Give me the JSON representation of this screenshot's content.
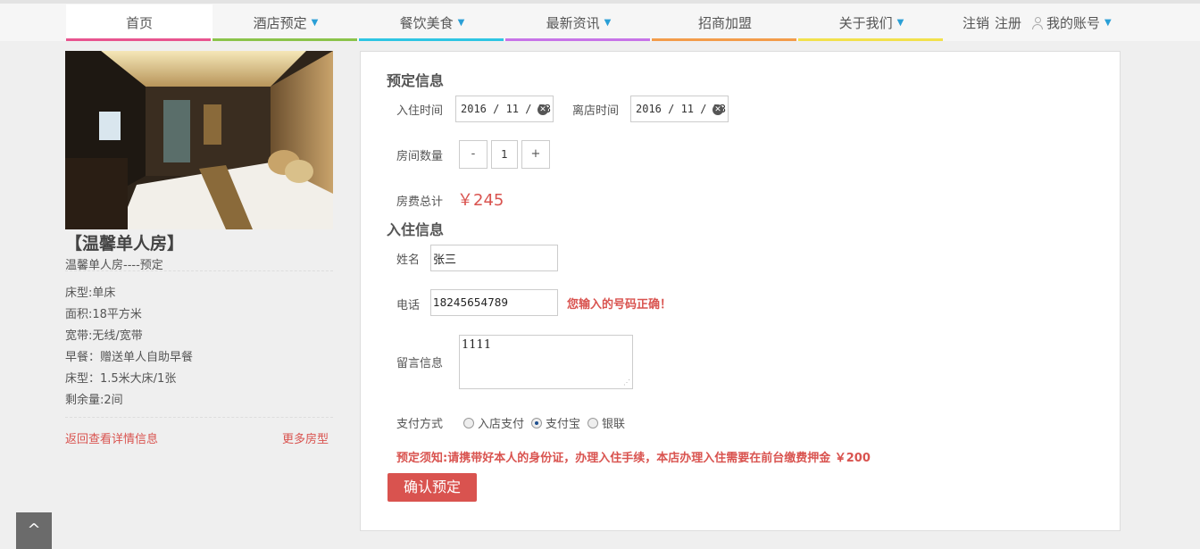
{
  "nav": {
    "items": [
      {
        "label": "首页",
        "caret": "",
        "color": "#e8548f"
      },
      {
        "label": "酒店预定",
        "caret": "▼",
        "color": "#8bc34a"
      },
      {
        "label": "餐饮美食",
        "caret": "▼",
        "color": "#2fc5e3"
      },
      {
        "label": "最新资讯",
        "caret": "▼",
        "color": "#c774e8"
      },
      {
        "label": "招商加盟",
        "caret": "",
        "color": "#f39c4a"
      },
      {
        "label": "关于我们",
        "caret": "▼",
        "color": "#f2e14c"
      }
    ],
    "logout": "注销",
    "register": "注册",
    "account": "我的账号",
    "account_caret": "▼"
  },
  "room": {
    "title": "【温馨单人房】",
    "subtitle": "温馨单人房----预定",
    "specs": [
      "床型:单床",
      "面积:18平方米",
      "宽带:无线/宽带",
      "早餐：赠送单人自助早餐",
      "床型：1.5米大床/1张",
      "剩余量:2间"
    ],
    "back_link": "返回查看详情信息",
    "more_link": "更多房型"
  },
  "booking": {
    "section_title": "预定信息",
    "checkin_label": "入住时间",
    "checkin_value": "2016 / 11 / 23",
    "checkout_label": "离店时间",
    "checkout_value": "2016 / 11 / 23",
    "rooms_label": "房间数量",
    "minus": "-",
    "quantity": "1",
    "plus": "+",
    "total_label": "房费总计",
    "total_value": "￥245"
  },
  "guest": {
    "section_title": "入住信息",
    "name_label": "姓名",
    "name_value": "张三",
    "phone_label": "电话",
    "phone_value": "18245654789",
    "phone_ok": "您输入的号码正确！",
    "memo_label": "留言信息",
    "memo_value": "1111",
    "pay_label": "支付方式",
    "pay_options": [
      "入店支付",
      "支付宝",
      "银联"
    ],
    "pay_selected": "支付宝",
    "notice": "预定须知:请携带好本人的身份证，办理入住手续，本店办理入住需要在前台缴费押金 ￥200",
    "confirm": "确认预定"
  },
  "to_top": "^"
}
